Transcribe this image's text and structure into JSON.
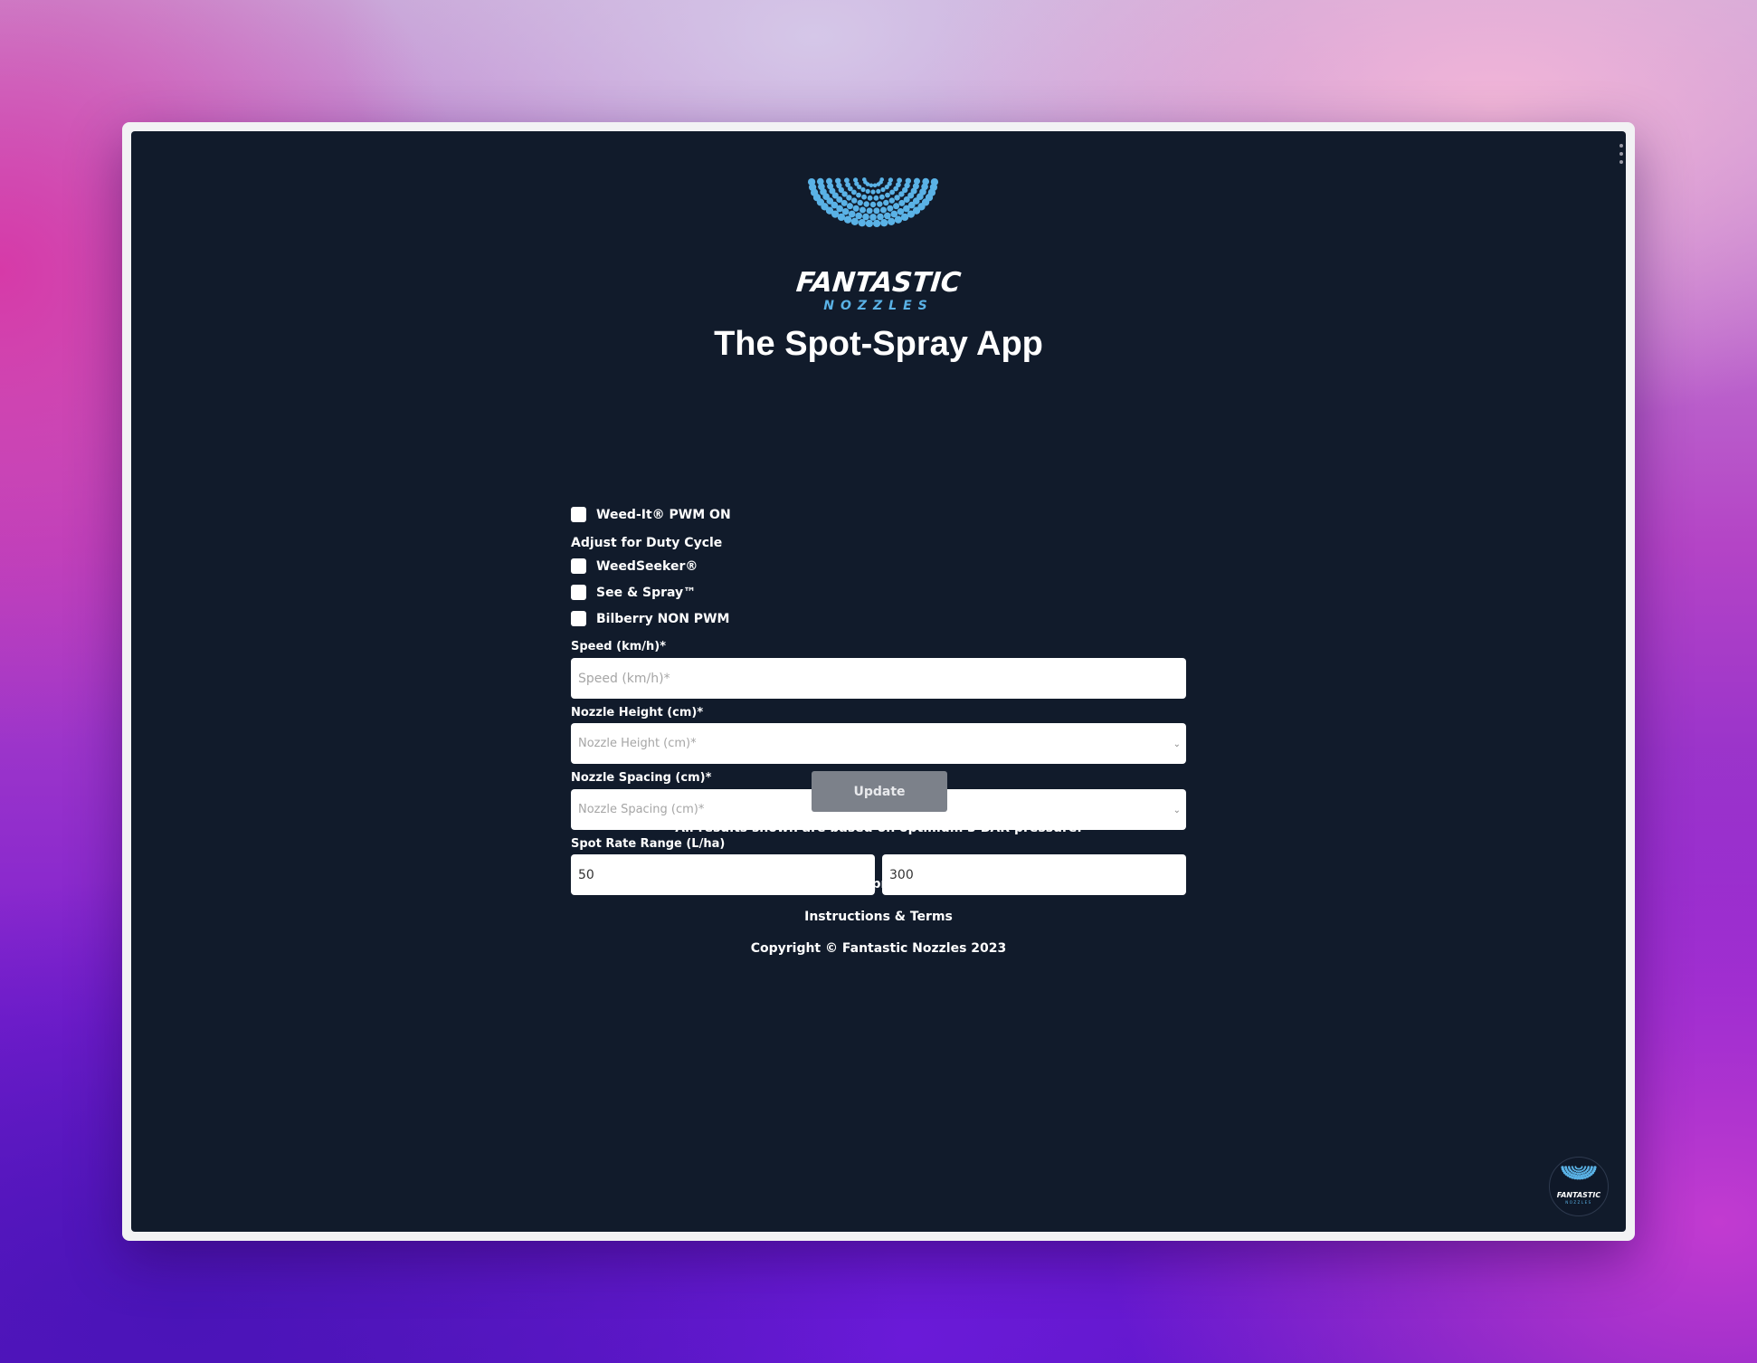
{
  "brand": {
    "name_top": "FANTASTIC",
    "name_bottom": "NOZZLES",
    "accent_color": "#5ab2e6",
    "logo_icon": "spray-dots-logo"
  },
  "page": {
    "title": "The Spot-Spray App"
  },
  "options": {
    "weed_it": "Weed-It® PWM ON",
    "duty_cycle_heading": "Adjust for Duty Cycle",
    "weedseeker": "WeedSeeker®",
    "see_spray": "See & Spray™",
    "bilberry": "Bilberry NON PWM"
  },
  "fields": {
    "speed": {
      "label": "Speed (km/h)*",
      "placeholder": "Speed (km/h)*",
      "value": ""
    },
    "nozzle_height": {
      "label": "Nozzle Height (cm)*",
      "placeholder": "Nozzle Height (cm)*"
    },
    "nozzle_spacing": {
      "label": "Nozzle Spacing (cm)*",
      "placeholder": "Nozzle Spacing (cm)*"
    },
    "spot_rate": {
      "label": "Spot Rate Range (L/ha)",
      "min": "50",
      "max": "300"
    }
  },
  "actions": {
    "update_label": "Update"
  },
  "footer": {
    "note": "All results shown are based on optimum 3 BAR pressure.",
    "buy_link": "Buy spot-spray nozzles",
    "instructions_link": "Instructions & Terms",
    "copyright": "Copyright © Fantastic Nozzles 2023"
  },
  "theme": {
    "background": "#111b2b",
    "button": "#7c818a"
  }
}
